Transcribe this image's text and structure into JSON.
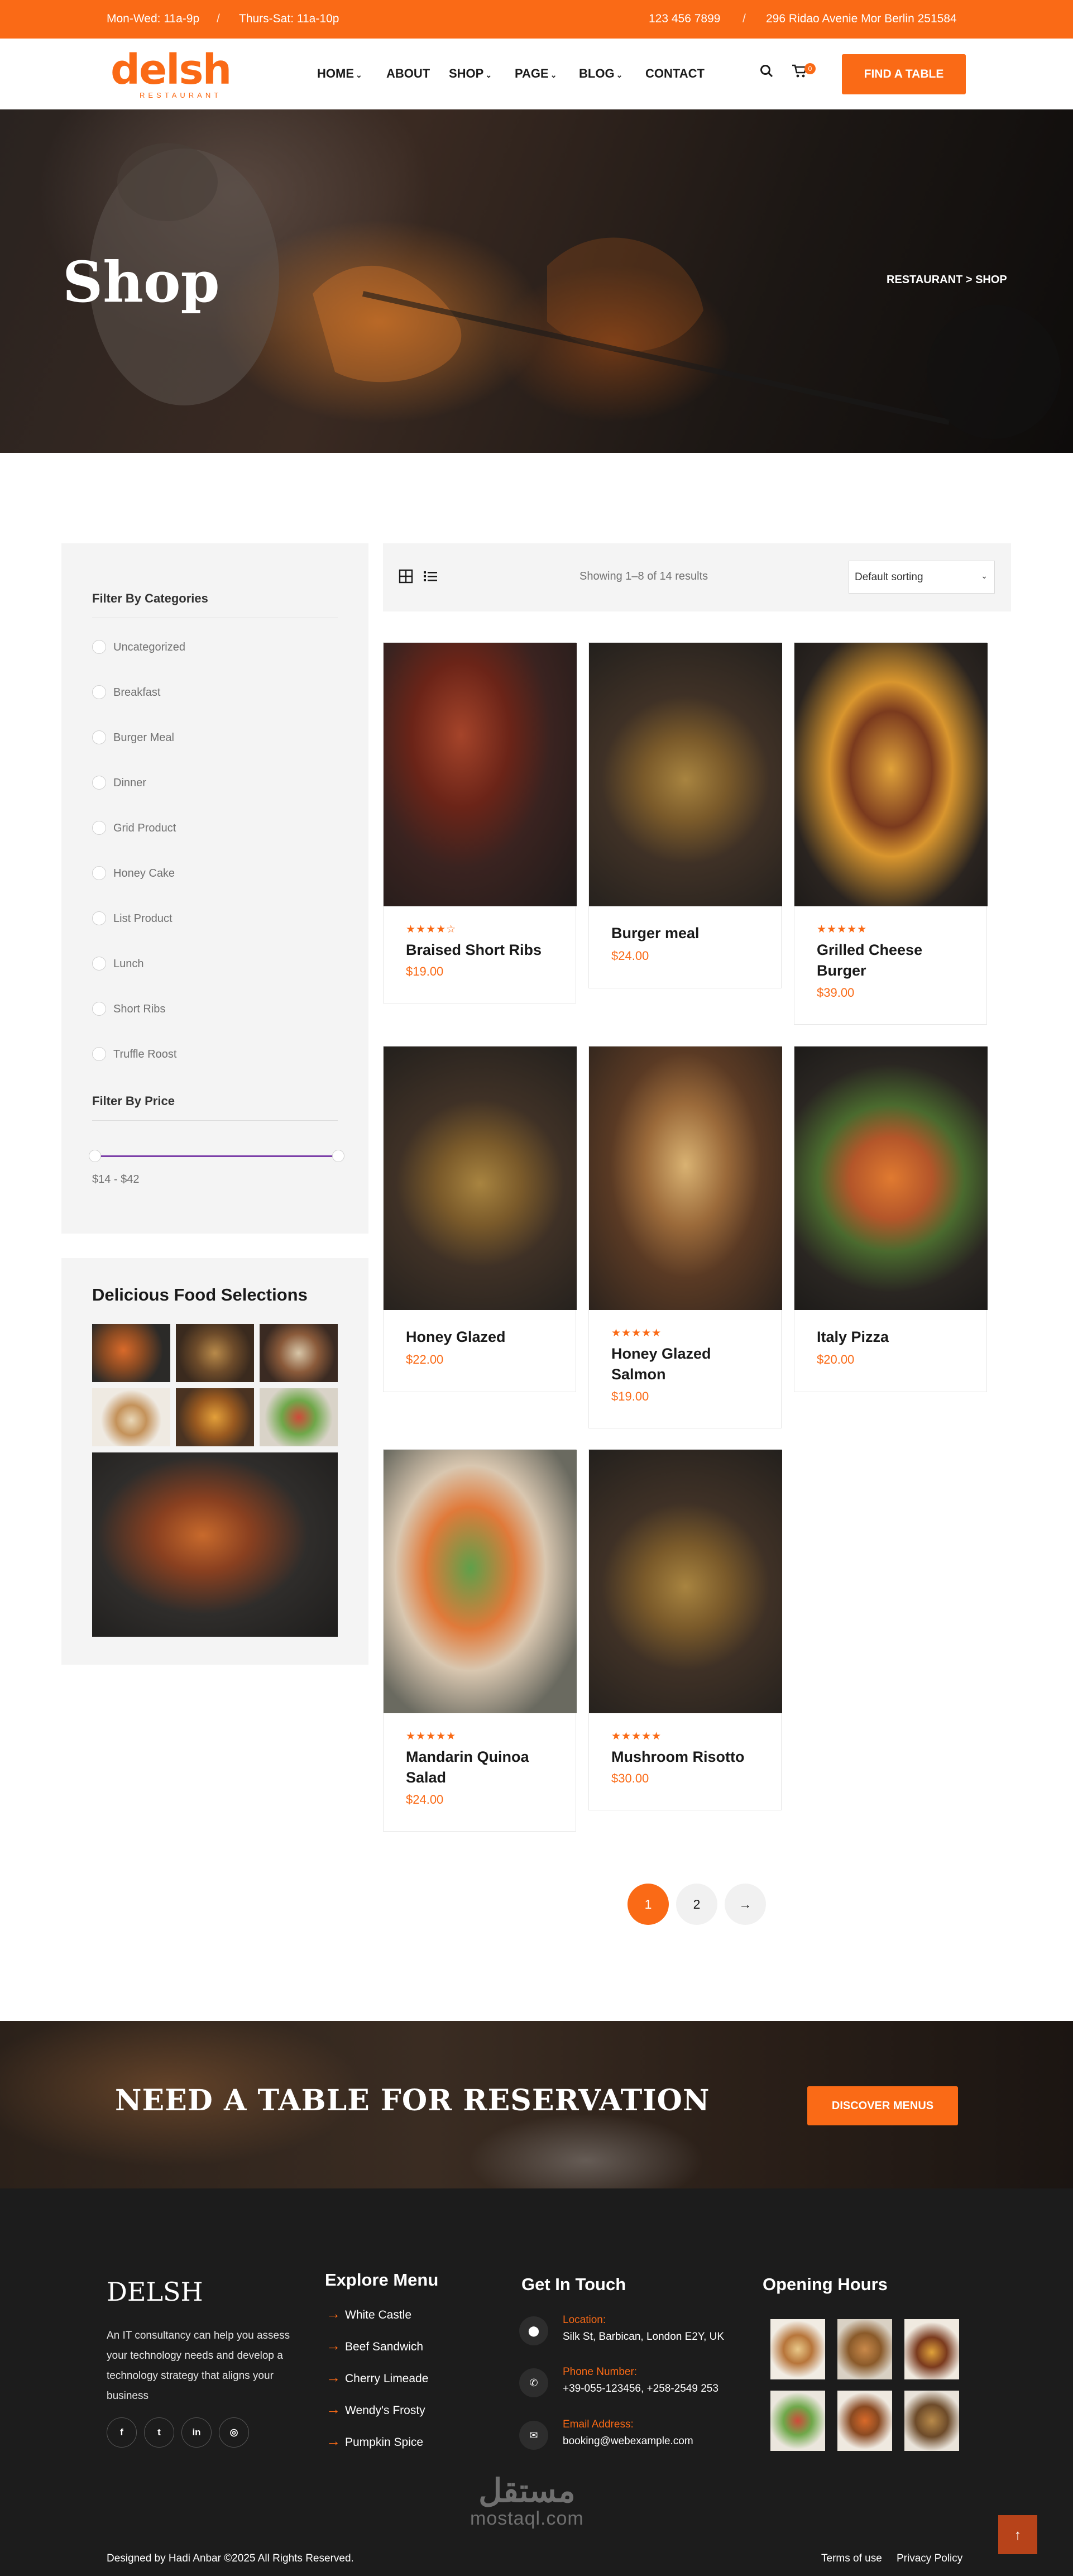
{
  "colors": {
    "accent": "#fa6a16",
    "dark": "#1c1c1c",
    "panel": "#f4f4f4"
  },
  "topbar": {
    "hours_weekday": "Mon-Wed: 11a-9p",
    "hours_weekend": "Thurs-Sat: 11a-10p",
    "phone": "123 456 7899",
    "address": "296 Ridao Avenie Mor Berlin 251584"
  },
  "header": {
    "logo_word": "delsh",
    "logo_sub": "RESTAURANT",
    "nav": [
      {
        "label": "HOME"
      },
      {
        "label": "ABOUT"
      },
      {
        "label": "SHOP"
      },
      {
        "label": "PAGE"
      },
      {
        "label": "BLOG"
      },
      {
        "label": "CONTACT"
      }
    ],
    "cart_count": "0",
    "cta": "FIND A TABLE",
    "icons": [
      "search-icon",
      "cart-icon"
    ]
  },
  "hero": {
    "title": "Shop",
    "breadcrumb": "RESTAURANT > SHOP"
  },
  "sidebar": {
    "categories_title": "Filter By Categories",
    "categories": [
      "Uncategorized",
      "Breakfast",
      "Burger Meal",
      "Dinner",
      "Grid Product",
      "Honey Cake",
      "List Product",
      "Lunch",
      "Short Ribs",
      "Truffle Roost"
    ],
    "price_title": "Filter By Price",
    "price_range": "$14 - $42",
    "gallery_title": "Delicious Food Selections"
  },
  "toolbar": {
    "showing": "Showing 1–8 of 14 results",
    "sort_selected": "Default sorting",
    "icons": [
      "grid-view-icon",
      "list-view-icon"
    ]
  },
  "products": [
    {
      "name": "Braised Short Ribs",
      "price": "$19.00",
      "stars": "★★★★☆",
      "rating": 4
    },
    {
      "name": "Burger meal",
      "price": "$24.00",
      "stars": "",
      "rating": 0
    },
    {
      "name": "Grilled Cheese Burger",
      "price": "$39.00",
      "stars": "★★★★★",
      "rating": 5
    },
    {
      "name": "Honey Glazed",
      "price": "$22.00",
      "stars": "",
      "rating": 0
    },
    {
      "name": "Honey Glazed Salmon",
      "price": "$19.00",
      "stars": "★★★★★",
      "rating": 5
    },
    {
      "name": "Italy Pizza",
      "price": "$20.00",
      "stars": "",
      "rating": 0
    },
    {
      "name": "Mandarin Quinoa Salad",
      "price": "$24.00",
      "stars": "★★★★★",
      "rating": 5
    },
    {
      "name": "Mushroom Risotto",
      "price": "$30.00",
      "stars": "★★★★★",
      "rating": 5
    }
  ],
  "pagination": {
    "pages": [
      "1",
      "2"
    ],
    "current": "1",
    "next": "→"
  },
  "reservation": {
    "title": "NEED A TABLE FOR RESERVATION",
    "cta": "DISCOVER MENUS"
  },
  "footer": {
    "brand": "DELSH",
    "description": "An IT consultancy can help you assess your technology needs and develop a technology strategy that aligns your business",
    "social": [
      {
        "icon": "facebook-icon",
        "glyph": "f"
      },
      {
        "icon": "twitter-icon",
        "glyph": "t"
      },
      {
        "icon": "linkedin-icon",
        "glyph": "in"
      },
      {
        "icon": "instagram-icon",
        "glyph": "◎"
      }
    ],
    "explore_title": "Explore Menu",
    "explore_items": [
      "White Castle",
      "Beef Sandwich",
      "Cherry Limeade",
      "Wendy's Frosty",
      "Pumpkin Spice"
    ],
    "contact_title": "Get In Touch",
    "contact": [
      {
        "label": "Location:",
        "value": "Silk St, Barbican, London E2Y, UK",
        "icon": "location-pin-icon",
        "glyph": "⬤"
      },
      {
        "label": "Phone Number:",
        "value": "+39-055-123456, +258-2549 253",
        "icon": "phone-icon",
        "glyph": "✆"
      },
      {
        "label": "Email Address:",
        "value": "booking@webexample.com",
        "icon": "email-icon",
        "glyph": "✉"
      }
    ],
    "hours_title": "Opening Hours",
    "copyright": "Designed by Hadi Anbar ©2025 All Rights Reserved.",
    "links": [
      "Terms of use",
      "Privacy Policy"
    ],
    "watermark_ar": "مستقل",
    "watermark_en": "mostaql.com",
    "to_top": "↑"
  }
}
